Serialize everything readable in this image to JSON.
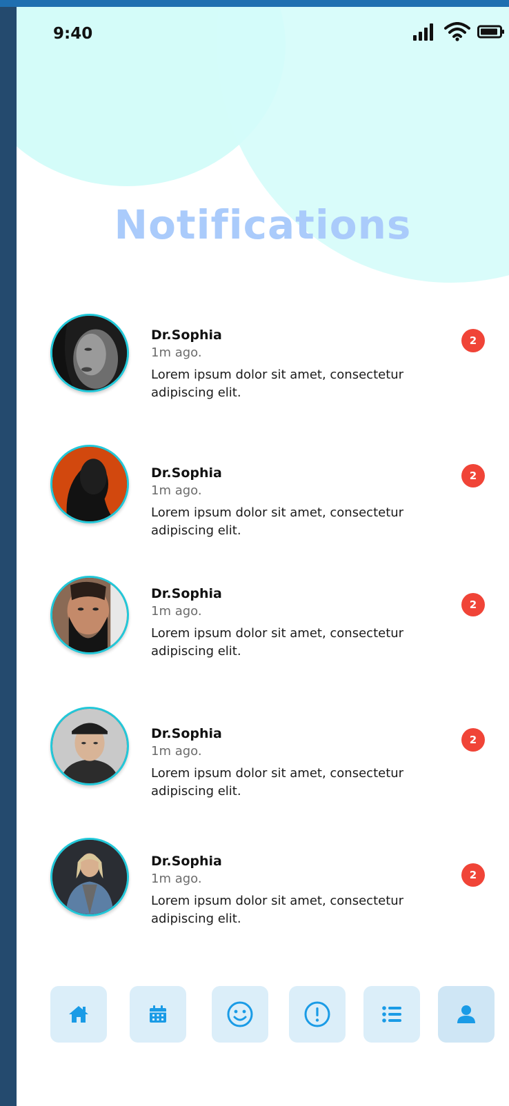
{
  "status_bar": {
    "time": "9:40",
    "icons": [
      "signal-icon",
      "wifi-icon",
      "battery-icon"
    ]
  },
  "page": {
    "title": "Notifications"
  },
  "notifications": [
    {
      "name": "Dr.Sophia",
      "time": "1m ago.",
      "message": "Lorem ipsum dolor sit amet, consectetur adipiscing elit.",
      "badge": "2",
      "avatar": "woman-portrait"
    },
    {
      "name": "Dr.Sophia",
      "time": "1m ago.",
      "message": "Lorem ipsum dolor sit amet, consectetur adipiscing elit.",
      "badge": "2",
      "avatar": "man-portrait-orange"
    },
    {
      "name": "Dr.Sophia",
      "time": "1m ago.",
      "message": "Lorem ipsum dolor sit amet, consectetur adipiscing elit.",
      "badge": "2",
      "avatar": "bearded-man-portrait"
    },
    {
      "name": "Dr.Sophia",
      "time": "1m ago.",
      "message": "Lorem ipsum dolor sit amet, consectetur adipiscing elit.",
      "badge": "2",
      "avatar": "man-cap-portrait"
    },
    {
      "name": "Dr.Sophia",
      "time": "1m ago.",
      "message": "Lorem ipsum dolor sit amet, consectetur adipiscing elit.",
      "badge": "2",
      "avatar": "woman-denim-portrait"
    }
  ],
  "bottom_nav": [
    {
      "icon": "home-icon"
    },
    {
      "icon": "calendar-icon"
    },
    {
      "icon": "smile-icon"
    },
    {
      "icon": "alert-icon"
    },
    {
      "icon": "list-icon"
    },
    {
      "icon": "user-icon",
      "active": true
    }
  ],
  "colors": {
    "accent": "#1a9be6",
    "badge": "#f04437",
    "avatar_ring": "#22c8d9",
    "bubble": "#d4fcf9",
    "title": "#aacbfb"
  }
}
